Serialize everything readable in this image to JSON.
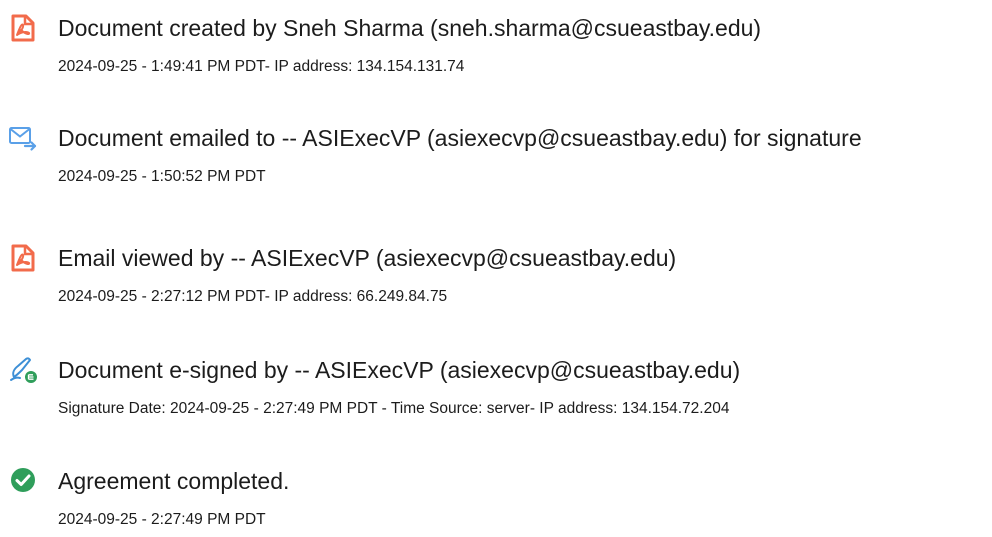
{
  "events": [
    {
      "icon": "document-created-icon",
      "title": "Document created by Sneh Sharma (sneh.sharma@csueastbay.edu)",
      "detail": "2024-09-25 - 1:49:41 PM PDT- IP address: 134.154.131.74"
    },
    {
      "icon": "email-sent-icon",
      "title": "Document emailed to -- ASIExecVP (asiexecvp@csueastbay.edu) for signature",
      "detail": "2024-09-25 - 1:50:52 PM PDT"
    },
    {
      "icon": "document-viewed-icon",
      "title": "Email viewed by -- ASIExecVP (asiexecvp@csueastbay.edu)",
      "detail": "2024-09-25 - 2:27:12 PM PDT- IP address: 66.249.84.75"
    },
    {
      "icon": "e-sign-pen-icon",
      "title": "Document e-signed by -- ASIExecVP (asiexecvp@csueastbay.edu)",
      "detail": "Signature Date: 2024-09-25 - 2:27:49 PM PDT - Time Source: server- IP address: 134.154.72.204"
    },
    {
      "icon": "checkmark-circle-icon",
      "title": "Agreement completed.",
      "detail": "2024-09-25 - 2:27:49 PM PDT"
    }
  ],
  "colors": {
    "acrobat_red": "#f26b4b",
    "email_blue": "#5aa0e8",
    "check_green": "#2f9e5b",
    "text": "#1c1c1c"
  }
}
